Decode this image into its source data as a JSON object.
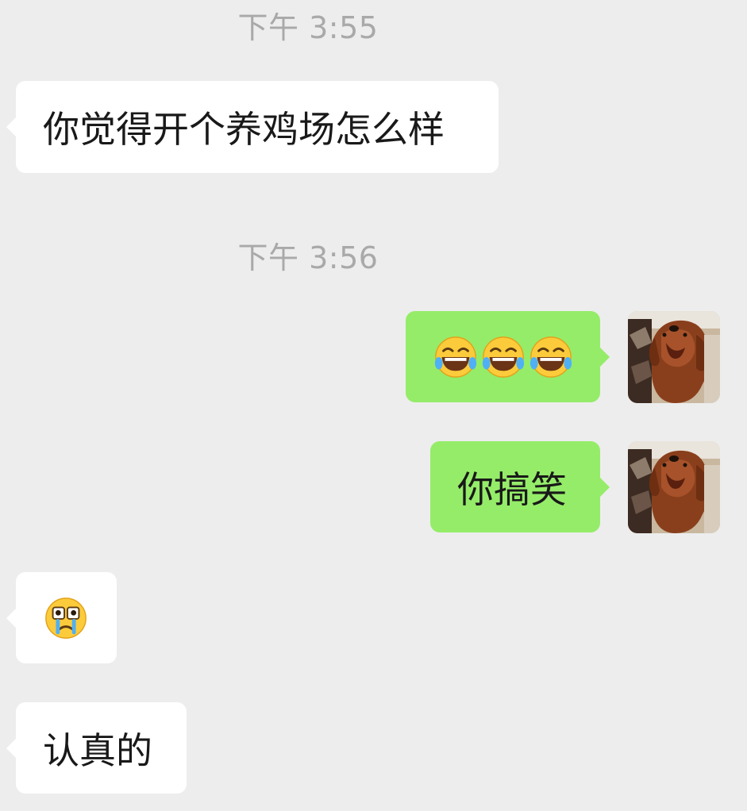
{
  "chat": {
    "timestamps": [
      "下午 3:55",
      "下午 3:56"
    ],
    "messages": [
      {
        "sender": "contact",
        "text": "你觉得开个养鸡场怎么样"
      },
      {
        "sender": "me",
        "emoji": [
          "tears-of-joy",
          "tears-of-joy",
          "tears-of-joy"
        ]
      },
      {
        "sender": "me",
        "text": "你搞笑"
      },
      {
        "sender": "contact",
        "emoji": [
          "crying-eyes"
        ]
      },
      {
        "sender": "contact",
        "text": "认真的"
      }
    ]
  },
  "colors": {
    "background": "#ededed",
    "incoming_bubble": "#ffffff",
    "outgoing_bubble": "#95ec69",
    "timestamp_text": "#a9a9a9",
    "message_text": "#191919"
  },
  "icons": {
    "my_avatar": "dog-avatar",
    "emoji_laugh": "tears-of-joy-emoji",
    "emoji_cry": "crying-emoji"
  }
}
